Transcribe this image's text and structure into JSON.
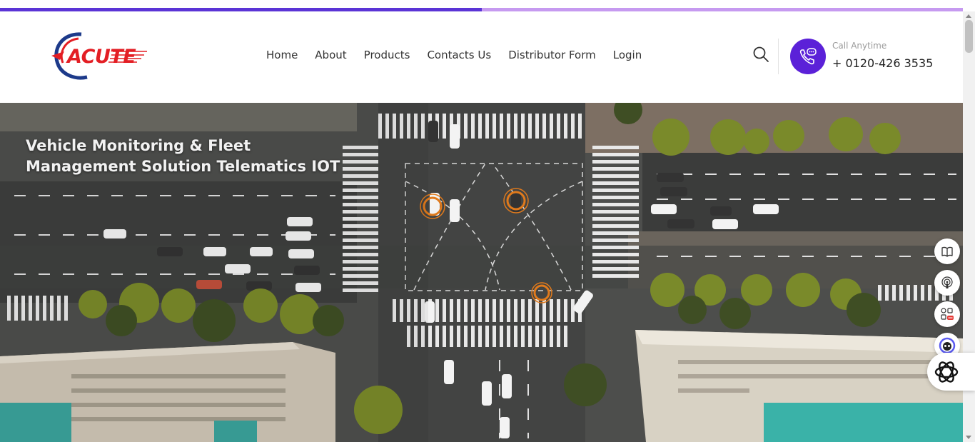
{
  "progress": {
    "fraction": 0.5
  },
  "brand": {
    "logo_text": "ACUTE"
  },
  "nav": {
    "items": [
      {
        "label": "Home"
      },
      {
        "label": "About"
      },
      {
        "label": "Products"
      },
      {
        "label": "Contacts Us"
      },
      {
        "label": "Distributor Form"
      },
      {
        "label": "Login"
      }
    ]
  },
  "contact": {
    "label": "Call Anytime",
    "number": "+ 0120-426 3535"
  },
  "hero": {
    "title": "Vehicle Monitoring & Fleet Management Solution Telematics IOT"
  },
  "colors": {
    "accent": "#5b21d8",
    "progress_track": "#c69af0",
    "logo_red": "#e31e24",
    "logo_blue": "#1d3a8a"
  },
  "icons": [
    "search-icon",
    "phone-chat-icon",
    "book-icon",
    "podcast-icon",
    "apps-new-icon",
    "assistant-face-icon",
    "openai-logo-icon"
  ]
}
